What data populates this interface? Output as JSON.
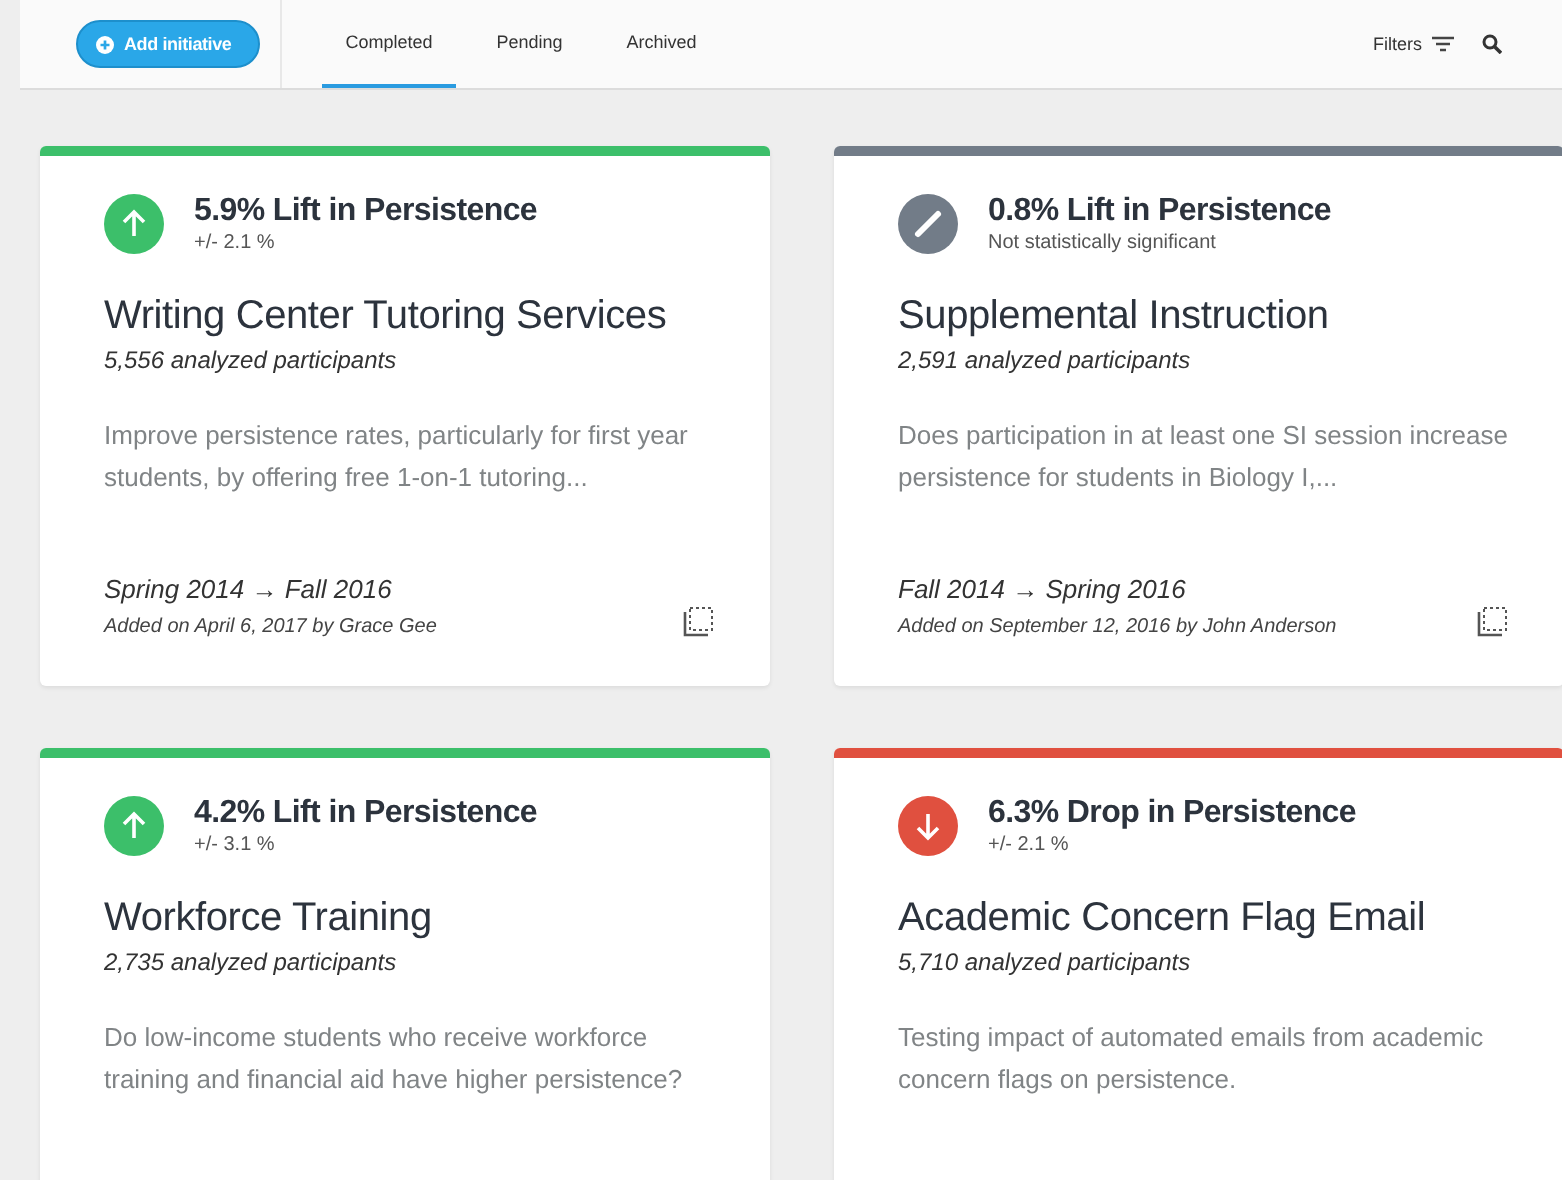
{
  "toolbar": {
    "add_button": "Add initiative",
    "tabs": [
      {
        "label": "Completed",
        "selected": true
      },
      {
        "label": "Pending",
        "selected": false
      },
      {
        "label": "Archived",
        "selected": false
      }
    ],
    "filters": "Filters"
  },
  "cards": [
    {
      "kind": "lift",
      "headline": "5.9% Lift in Persistence",
      "margin": "+/- 2.1 %",
      "title": "Writing Center Tutoring Services",
      "participants": "5,556 analyzed participants",
      "description": "Improve persistence rates, particularly for first year students, by offering free 1-on-1 tutoring...",
      "dates": "Spring 2014 → Fall 2016",
      "added": "Added on April 6, 2017 by Grace Gee"
    },
    {
      "kind": "neutral",
      "headline": "0.8% Lift in Persistence",
      "margin": "Not statistically significant",
      "title": "Supplemental Instruction",
      "participants": "2,591 analyzed participants",
      "description": "Does participation in at least one SI session increase persistence for students in Biology I,...",
      "dates": "Fall 2014 → Spring 2016",
      "added": "Added on September 12, 2016 by John Anderson"
    },
    {
      "kind": "lift",
      "headline": "4.2% Lift in Persistence",
      "margin": "+/- 3.1 %",
      "title": "Workforce Training",
      "participants": "2,735 analyzed participants",
      "description": "Do low-income students who receive workforce training and financial aid have higher persistence?"
    },
    {
      "kind": "drop",
      "headline": "6.3% Drop in Persistence",
      "margin": "+/- 2.1 %",
      "title": "Academic Concern Flag Email",
      "participants": "5,710 analyzed participants",
      "description": "Testing impact of automated emails from academic concern flags on persistence."
    }
  ]
}
